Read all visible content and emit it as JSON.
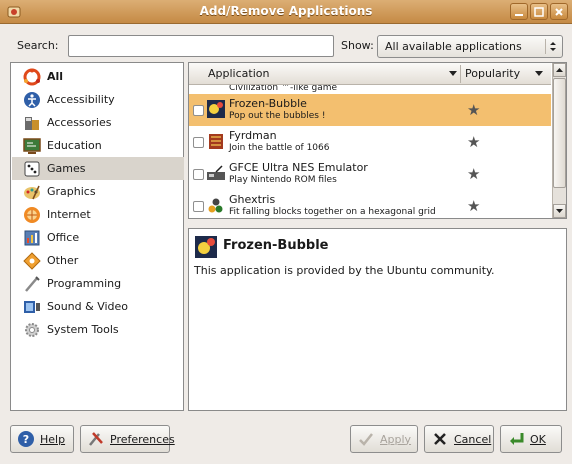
{
  "window": {
    "title": "Add/Remove Applications"
  },
  "search": {
    "label": "Search:",
    "value": ""
  },
  "show": {
    "label": "Show:",
    "selected": "All available applications"
  },
  "categories": [
    {
      "label": "All",
      "icon": "all-icon",
      "bold": true
    },
    {
      "label": "Accessibility",
      "icon": "accessibility-icon"
    },
    {
      "label": "Accessories",
      "icon": "accessories-icon"
    },
    {
      "label": "Education",
      "icon": "education-icon"
    },
    {
      "label": "Games",
      "icon": "games-icon",
      "selected": true
    },
    {
      "label": "Graphics",
      "icon": "graphics-icon"
    },
    {
      "label": "Internet",
      "icon": "internet-icon"
    },
    {
      "label": "Office",
      "icon": "office-icon"
    },
    {
      "label": "Other",
      "icon": "other-icon"
    },
    {
      "label": "Programming",
      "icon": "programming-icon"
    },
    {
      "label": "Sound & Video",
      "icon": "sound-video-icon"
    },
    {
      "label": "System Tools",
      "icon": "system-tools-icon"
    }
  ],
  "applist": {
    "col_application": "Application",
    "col_popularity": "Popularity",
    "partial_row": "Civilization ™-like game",
    "rows": [
      {
        "name": "Frozen-Bubble",
        "desc": "Pop out the bubbles !",
        "selected": true,
        "icon": "frozen-bubble-icon"
      },
      {
        "name": "Fyrdman",
        "desc": "Join the battle of 1066",
        "icon": "fyrdman-icon"
      },
      {
        "name": "GFCE Ultra NES Emulator",
        "desc": "Play Nintendo ROM files",
        "icon": "nes-emulator-icon"
      },
      {
        "name": "Ghextris",
        "desc": "Fit falling blocks together on a hexagonal grid",
        "icon": "ghextris-icon"
      }
    ],
    "star_glyph": "★"
  },
  "detail": {
    "title": "Frozen-Bubble",
    "text": "This application is provided by the Ubuntu community."
  },
  "buttons": {
    "help": "Help",
    "preferences": "Preferences",
    "apply": "Apply",
    "cancel": "Cancel",
    "ok": "OK"
  },
  "colors": {
    "titlebar": "#c58a45",
    "selection": "#f3bf6f",
    "window_bg": "#efebe7"
  }
}
